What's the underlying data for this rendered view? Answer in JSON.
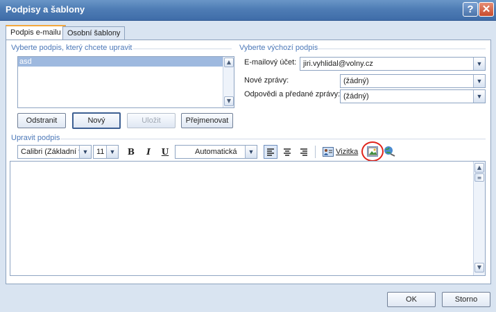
{
  "window": {
    "title": "Podpisy a šablony",
    "help": "?",
    "close": "✕"
  },
  "tabs": [
    "Podpis e-mailu",
    "Osobní šablony"
  ],
  "left_group": {
    "title": "Vyberte podpis, který chcete upravit",
    "items": [
      "asd"
    ],
    "buttons": {
      "delete": "Odstranit",
      "new": "Nový",
      "save": "Uložit",
      "rename": "Přejmenovat"
    }
  },
  "right_group": {
    "title": "Vyberte výchozí podpis",
    "account_label": "E-mailový účet:",
    "account_value": "jiri.vyhlidal@volny.cz",
    "new_label": "Nové zprávy:",
    "new_value": "(žádný)",
    "reply_label": "Odpovědi a předané zprávy:",
    "reply_value": "(žádný)"
  },
  "edit_group": {
    "title": "Upravit podpis",
    "font": "Calibri (Základní tex",
    "size": "11",
    "bold": "B",
    "italic": "I",
    "underline": "U",
    "color": "Automatická",
    "vcard": "Vizitka"
  },
  "footer": {
    "ok": "OK",
    "cancel": "Storno"
  },
  "colors": {
    "accent": "#4c78b8",
    "titlebar": "#4f7db5",
    "highlight_circle": "#e0241b"
  }
}
